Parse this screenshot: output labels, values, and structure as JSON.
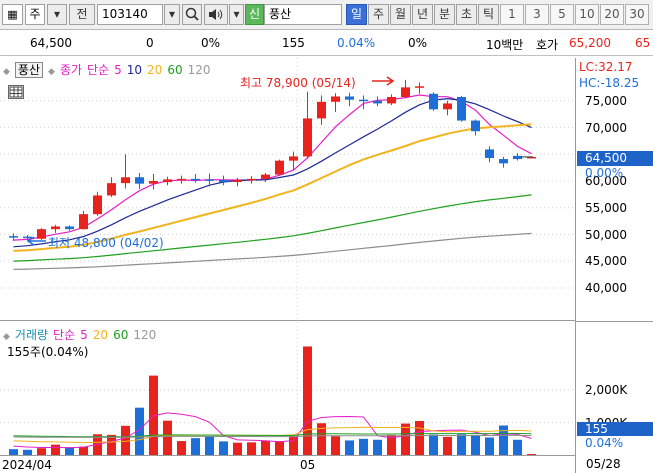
{
  "toolbar": {
    "type_label": "주",
    "prev_label": "전",
    "code_value": "103140",
    "name_label": "신",
    "stock_name": "풍산",
    "periods": [
      "일",
      "주",
      "월",
      "년",
      "분",
      "초",
      "틱"
    ],
    "active_period": "일",
    "intervals": [
      "1",
      "3",
      "5",
      "10",
      "20",
      "30"
    ]
  },
  "quote": {
    "price": "64,500",
    "change": "0",
    "change_pct": "0%",
    "volume": "155",
    "volume_pct": "0.04%",
    "other_pct": "0%",
    "amount": "10백만",
    "ask_label": "호가",
    "ask_price": "65,200",
    "bid_price": "65"
  },
  "price_panel": {
    "tag": "풍산",
    "legend": {
      "name": "종가",
      "kind": "단순",
      "periods": [
        "5",
        "10",
        "20",
        "60",
        "120"
      ]
    },
    "high_label": "최고 78,900 (05/14)",
    "low_label": "최저 48,800 (04/02)",
    "lc": "LC:32.17",
    "hc": "HC:-18.25",
    "axis_ticks": [
      "75,000",
      "70,000",
      "65,000",
      "60,000",
      "55,000",
      "50,000",
      "45,000",
      "40,000"
    ],
    "current_price": "64,500",
    "current_pct": "0.00%"
  },
  "volume_panel": {
    "legend": {
      "name": "거래량",
      "kind": "단순",
      "periods": [
        "5",
        "20",
        "60",
        "120"
      ]
    },
    "info": "155주(0.04%)",
    "axis_ticks": [
      "2,000K",
      "1,000K"
    ],
    "current": "155",
    "current_pct": "0.04%"
  },
  "dates": {
    "left": "2024/04",
    "mid": "05",
    "right": "05/28"
  },
  "colors": {
    "up": "#e8231e",
    "down": "#1e6ed8",
    "ma5": "#e61ec8",
    "ma10": "#1e2896",
    "ma20": "#f0b41e",
    "ma60": "#1ea01e",
    "ma120": "#8c8c8c"
  },
  "chart_data": {
    "type": "candlestick",
    "x_range": [
      "2024/04/01",
      "2024/05/28"
    ],
    "ohlc": [
      [
        49700,
        50200,
        48800,
        49600
      ],
      [
        49600,
        49900,
        48900,
        49400
      ],
      [
        49200,
        51200,
        49000,
        51000
      ],
      [
        51000,
        51800,
        50300,
        51500
      ],
      [
        51500,
        51700,
        50700,
        51000
      ],
      [
        51000,
        54400,
        50900,
        53800
      ],
      [
        53800,
        58000,
        53500,
        57300
      ],
      [
        57300,
        60700,
        57000,
        59600
      ],
      [
        59600,
        65000,
        58600,
        60700
      ],
      [
        60700,
        61500,
        58500,
        59500
      ],
      [
        59500,
        61300,
        58400,
        60000
      ],
      [
        59800,
        60800,
        59200,
        60300
      ],
      [
        60300,
        61000,
        59500,
        60400
      ],
      [
        60400,
        61300,
        59700,
        60300
      ],
      [
        60300,
        61400,
        59000,
        60200
      ],
      [
        60200,
        61000,
        59200,
        59800
      ],
      [
        59800,
        60600,
        59000,
        60200
      ],
      [
        60200,
        60900,
        59500,
        60400
      ],
      [
        60400,
        61500,
        59800,
        61200
      ],
      [
        61200,
        64000,
        61000,
        63800
      ],
      [
        63800,
        65500,
        62000,
        64600
      ],
      [
        64600,
        76700,
        64200,
        71700
      ],
      [
        71700,
        76000,
        70500,
        74800
      ],
      [
        74800,
        76400,
        72900,
        75800
      ],
      [
        75800,
        76500,
        74000,
        75200
      ],
      [
        75200,
        76000,
        73400,
        75000
      ],
      [
        75000,
        75800,
        74000,
        74500
      ],
      [
        74500,
        76200,
        74200,
        75700
      ],
      [
        75700,
        78900,
        75500,
        77500
      ],
      [
        77500,
        78400,
        76300,
        77700
      ],
      [
        76300,
        76600,
        73100,
        73400
      ],
      [
        73400,
        75000,
        72300,
        74500
      ],
      [
        75700,
        75900,
        71100,
        71300
      ],
      [
        71300,
        71500,
        68500,
        69300
      ],
      [
        65900,
        66500,
        63500,
        64300
      ],
      [
        64100,
        64500,
        62500,
        63300
      ],
      [
        64700,
        65200,
        63800,
        64100
      ],
      [
        64500,
        64500,
        64500,
        64500
      ]
    ],
    "volume_k": [
      180,
      160,
      210,
      320,
      240,
      260,
      640,
      620,
      900,
      1460,
      2450,
      1060,
      430,
      520,
      580,
      420,
      380,
      390,
      440,
      430,
      580,
      3350,
      980,
      580,
      450,
      500,
      470,
      620,
      970,
      1050,
      630,
      560,
      640,
      620,
      540,
      910,
      470,
      0.155
    ],
    "ma_periods": [
      5,
      10,
      20,
      60,
      120
    ],
    "y_range": [
      36000,
      80000
    ],
    "vol_range": [
      0,
      3500
    ]
  }
}
